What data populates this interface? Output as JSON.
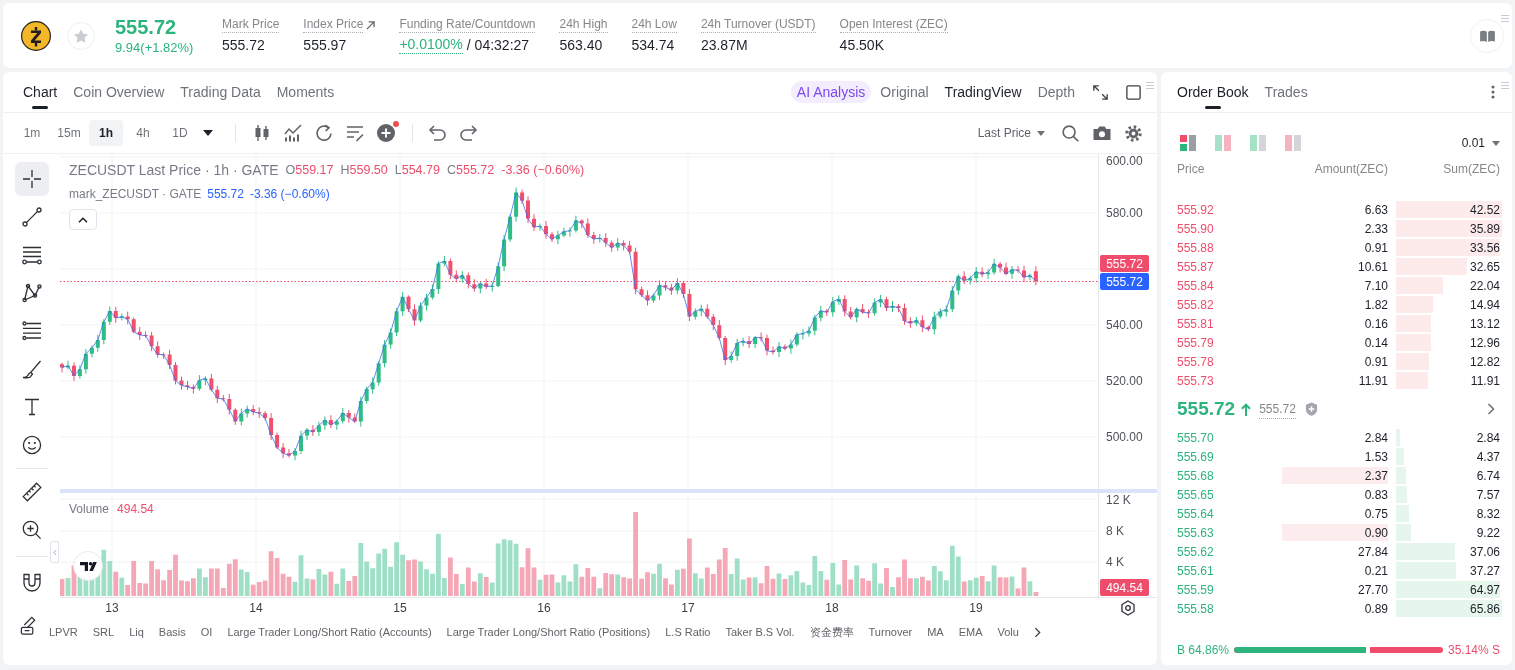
{
  "header": {
    "price": "555.72",
    "change": "9.94(+1.82%)",
    "stats": [
      {
        "kind": "plain",
        "label": "Mark Price",
        "value": "555.72"
      },
      {
        "kind": "link",
        "label": "Index Price",
        "value": "555.97"
      },
      {
        "kind": "funding",
        "label": "Funding Rate/Countdown",
        "value": "+0.0100%",
        "countdown": "/ 04:32:27"
      },
      {
        "kind": "plain",
        "label": "24h High",
        "value": "563.40"
      },
      {
        "kind": "plain",
        "label": "24h Low",
        "value": "534.74"
      },
      {
        "kind": "plain",
        "label": "24h Turnover (USDT)",
        "value": "23.87M"
      },
      {
        "kind": "plain",
        "label": "Open Interest (ZEC)",
        "value": "45.50K"
      }
    ]
  },
  "chart_panel": {
    "tabs": [
      {
        "label": "Chart",
        "selected": true
      },
      {
        "label": "Coin Overview",
        "selected": false
      },
      {
        "label": "Trading Data",
        "selected": false
      },
      {
        "label": "Moments",
        "selected": false
      }
    ],
    "ai_button": {
      "label": "AI Analysis"
    },
    "views": [
      {
        "label": "Original",
        "selected": false
      },
      {
        "label": "TradingView",
        "selected": true
      },
      {
        "label": "Depth",
        "selected": false
      }
    ],
    "intervals": [
      {
        "label": "1m",
        "selected": false
      },
      {
        "label": "15m",
        "selected": false
      },
      {
        "label": "1h",
        "selected": true
      },
      {
        "label": "4h",
        "selected": false
      },
      {
        "label": "1D",
        "selected": false
      }
    ],
    "price_source": "Last Price",
    "tool_groups": [
      [
        {
          "kind": "crosshair",
          "selected": true
        },
        {
          "kind": "trend_line",
          "selected": false
        },
        {
          "kind": "parallel_lines",
          "selected": false
        },
        {
          "kind": "pattern",
          "selected": false
        },
        {
          "kind": "fib",
          "selected": false
        },
        {
          "kind": "brush",
          "selected": false
        },
        {
          "kind": "text",
          "selected": false
        },
        {
          "kind": "emoji",
          "selected": false
        }
      ],
      [
        {
          "kind": "ruler",
          "selected": false
        },
        {
          "kind": "zoom",
          "selected": false
        }
      ],
      [
        {
          "kind": "magnet",
          "selected": false
        }
      ]
    ],
    "legend": {
      "title": "ZECUSDT Last Price · 1h · GATE",
      "ohlc": [
        {
          "key": "O",
          "value": "559.17"
        },
        {
          "key": "H",
          "value": "559.50"
        },
        {
          "key": "L",
          "value": "554.79"
        },
        {
          "key": "C",
          "value": "555.72"
        }
      ],
      "change": "-3.36 (−0.60%)"
    },
    "mark_legend": {
      "title": "mark_ZECUSDT · GATE",
      "value": "555.72",
      "change": "-3.36 (−0.60%)"
    },
    "price_axis": [
      "600.00",
      "580.00",
      "540.00",
      "520.00",
      "500.00"
    ],
    "last_price_tag": "555.72",
    "mark_price_tag": "555.72",
    "volume": {
      "label": "Volume",
      "value": "494.54",
      "axis": [
        "12 K",
        "8 K",
        "4 K"
      ],
      "tag": "494.54"
    },
    "time_axis": [
      "13",
      "14",
      "15",
      "16",
      "17",
      "18",
      "19"
    ],
    "indicators": [
      "LPVR",
      "SRL",
      "Liq",
      "Basis",
      "OI",
      "Large Trader Long/Short Ratio (Accounts)",
      "Large Trader Long/Short Ratio (Positions)",
      "L.S Ratio",
      "Taker B.S Vol.",
      "资金费率",
      "Turnover",
      "MA",
      "EMA",
      "Volu"
    ]
  },
  "order_book": {
    "tabs": [
      {
        "label": "Order Book",
        "selected": true
      },
      {
        "label": "Trades",
        "selected": false
      }
    ],
    "layouts": [
      {
        "kind": "both",
        "selected": true
      },
      {
        "kind": "split",
        "selected": false
      },
      {
        "kind": "bids",
        "selected": false
      },
      {
        "kind": "asks",
        "selected": false
      }
    ],
    "precision": "0.01",
    "columns": [
      "Price",
      "Amount(ZEC)",
      "Sum(ZEC)"
    ],
    "asks": [
      {
        "price": "555.92",
        "amount": "6.63",
        "sum": "42.52",
        "level": 1
      },
      {
        "price": "555.90",
        "amount": "2.33",
        "sum": "35.89",
        "level": 1
      },
      {
        "price": "555.88",
        "amount": "0.91",
        "sum": "33.56",
        "level": 0.98
      },
      {
        "price": "555.87",
        "amount": "10.61",
        "sum": "32.65",
        "level": 0.67
      },
      {
        "price": "555.84",
        "amount": "7.10",
        "sum": "22.04",
        "level": 0.44
      },
      {
        "price": "555.82",
        "amount": "1.82",
        "sum": "14.94",
        "level": 0.35
      },
      {
        "price": "555.81",
        "amount": "0.16",
        "sum": "13.12",
        "level": 0.33
      },
      {
        "price": "555.79",
        "amount": "0.14",
        "sum": "12.96",
        "level": 0.33
      },
      {
        "price": "555.78",
        "amount": "0.91",
        "sum": "12.82",
        "level": 0.31
      },
      {
        "price": "555.73",
        "amount": "11.91",
        "sum": "11.91",
        "level": 0.3
      }
    ],
    "mid": {
      "price": "555.72",
      "mark": "555.72"
    },
    "bids": [
      {
        "price": "555.70",
        "amount": "2.84",
        "sum": "2.84",
        "level": 0.04,
        "highlighted": false
      },
      {
        "price": "555.69",
        "amount": "1.53",
        "sum": "4.37",
        "level": 0.08,
        "highlighted": false
      },
      {
        "price": "555.68",
        "amount": "2.37",
        "sum": "6.74",
        "level": 0.09,
        "highlighted": true
      },
      {
        "price": "555.65",
        "amount": "0.83",
        "sum": "7.57",
        "level": 0.1,
        "highlighted": false
      },
      {
        "price": "555.64",
        "amount": "0.75",
        "sum": "8.32",
        "level": 0.12,
        "highlighted": false
      },
      {
        "price": "555.63",
        "amount": "0.90",
        "sum": "9.22",
        "level": 0.14,
        "highlighted": true
      },
      {
        "price": "555.62",
        "amount": "27.84",
        "sum": "37.06",
        "level": 0.56,
        "highlighted": false
      },
      {
        "price": "555.61",
        "amount": "0.21",
        "sum": "37.27",
        "level": 0.57,
        "highlighted": false
      },
      {
        "price": "555.59",
        "amount": "27.70",
        "sum": "64.97",
        "level": 0.98,
        "highlighted": false
      },
      {
        "price": "555.58",
        "amount": "0.89",
        "sum": "65.86",
        "level": 1,
        "highlighted": false
      }
    ],
    "ratio": {
      "buy": "B 64.86%",
      "sell": "35.14% S",
      "level": 0.6486
    }
  }
}
